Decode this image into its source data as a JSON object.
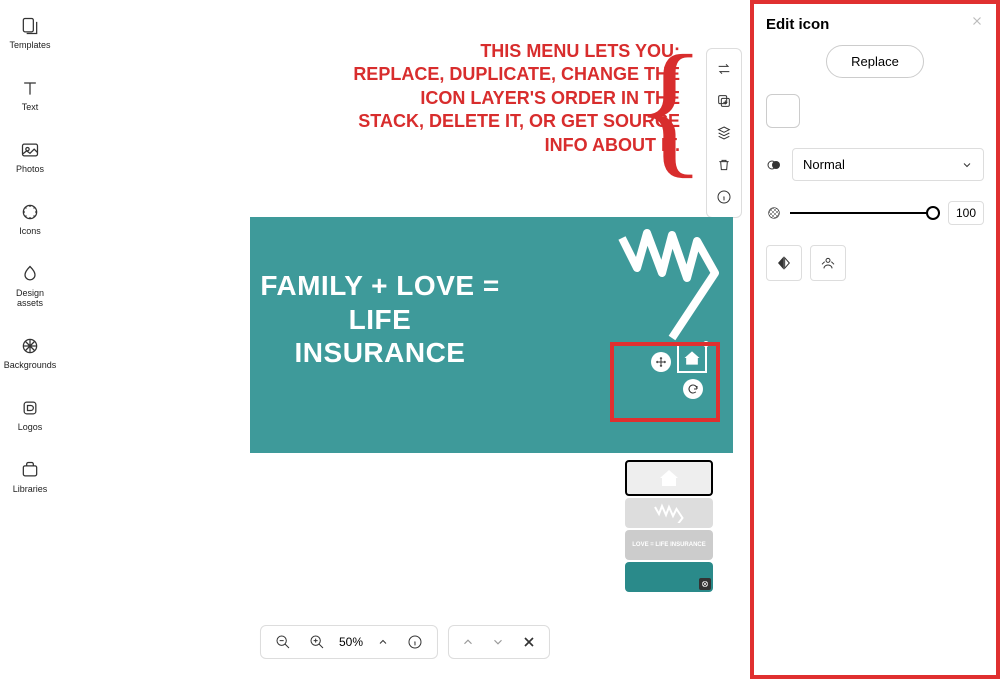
{
  "sidebar": {
    "items": [
      {
        "label": "Templates"
      },
      {
        "label": "Text"
      },
      {
        "label": "Photos"
      },
      {
        "label": "Icons"
      },
      {
        "label": "Design assets"
      },
      {
        "label": "Backgrounds"
      },
      {
        "label": "Logos"
      },
      {
        "label": "Libraries"
      }
    ]
  },
  "annotation": {
    "line1": "THIS MENU LETS YOU:",
    "line2": "REPLACE, DUPLICATE, CHANGE THE",
    "line3": "ICON LAYER'S ORDER IN THE",
    "line4": "STACK, DELETE IT, OR GET SOURCE",
    "line5": "INFO ABOUT IT."
  },
  "design": {
    "headline": "FAMILY + LOVE = LIFE INSURANCE",
    "overlay_color": "#1a8e8e"
  },
  "layer_thumbs": {
    "text_label": "LOVE = LIFE INSURANCE"
  },
  "zoom": {
    "level": "50%"
  },
  "panel": {
    "title": "Edit icon",
    "replace": "Replace",
    "blend_mode": "Normal",
    "opacity": "100"
  }
}
